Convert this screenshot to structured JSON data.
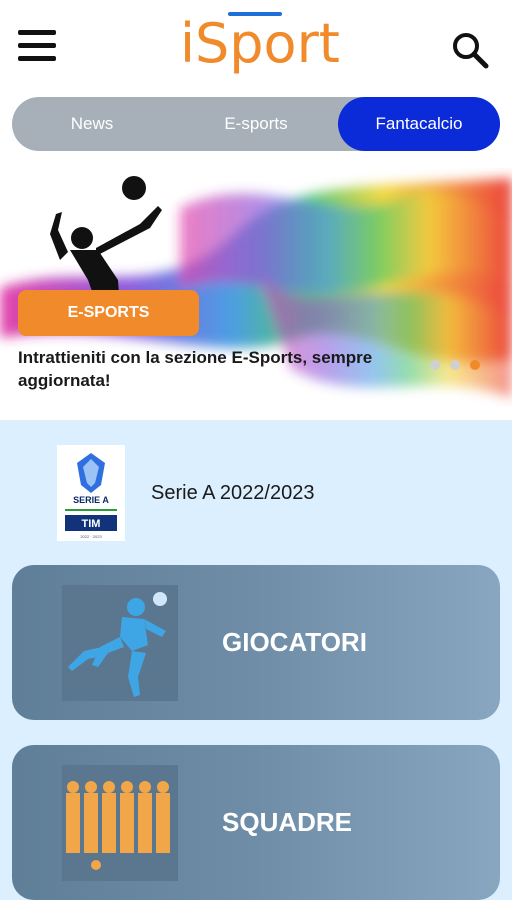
{
  "header": {
    "logo": "iSport",
    "menu_icon": "hamburger-icon",
    "search_icon": "search-icon"
  },
  "tabs": [
    {
      "label": "News",
      "active": false
    },
    {
      "label": "E-sports",
      "active": false
    },
    {
      "label": "Fantacalcio",
      "active": true
    }
  ],
  "banner": {
    "badge": "E-SPORTS",
    "caption": "Intrattieniti con la sezione E-Sports, sempre aggiornata!",
    "slides": 3,
    "active_slide": 3
  },
  "league": {
    "title": "Serie A 2022/2023",
    "logo_text": "SERIE A",
    "sponsor": "TIM",
    "logo_years": "2022 · 2023"
  },
  "cards": {
    "players": "GIOCATORI",
    "teams": "SQUADRE"
  },
  "colors": {
    "accent": "#f08a2a",
    "tab_active": "#0b2bd8",
    "tab_bar": "#a7b0b9",
    "panel": "#dcefff"
  }
}
